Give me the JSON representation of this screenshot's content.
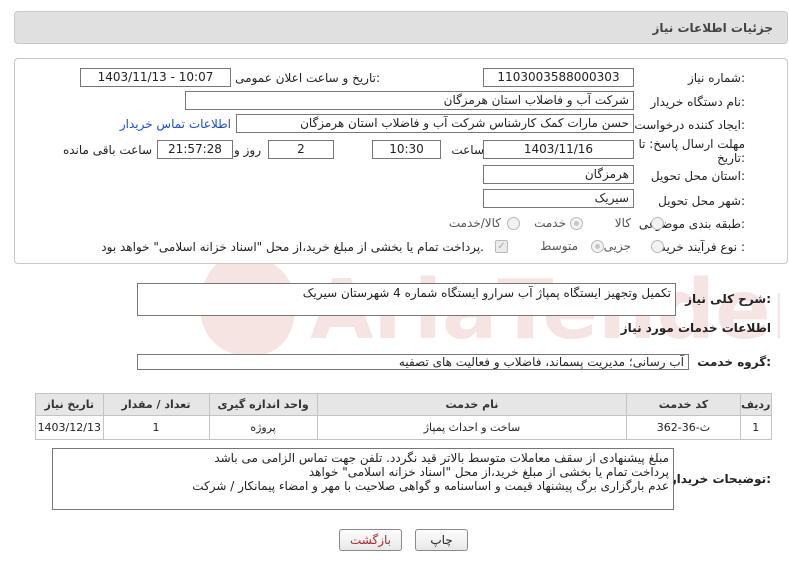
{
  "header": {
    "title": "جزئیات اطلاعات نیاز"
  },
  "fields": {
    "need_number_label": "شماره نیاز:",
    "need_number": "1103003588000303",
    "announce_label": "تاریخ و ساعت اعلان عمومی:",
    "announce_value": "1403/11/13 - 10:07",
    "buyer_org_label": "نام دستگاه خریدار:",
    "buyer_org": "شرکت آب و فاضلاب استان هرمزگان",
    "creator_label": "ایجاد کننده درخواست:",
    "creator": "حسن مارات کمک کارشناس شرکت آب و فاضلاب استان هرمزگان",
    "contact_link": "اطلاعات تماس خریدار",
    "deadline_label_1": "مهلت ارسال پاسخ: تا",
    "deadline_label_2": "تاریخ:",
    "deadline_date": "1403/11/16",
    "time_label": "ساعت",
    "deadline_time": "10:30",
    "days_value": "2",
    "days_label": "روز و",
    "remaining_time": "21:57:28",
    "remaining_label": "ساعت باقی مانده",
    "province_label": "استان محل تحویل:",
    "province": "هرمزگان",
    "city_label": "شهر محل تحویل:",
    "city": "سیریک",
    "category_label": "طبقه بندی موضوعی:",
    "category_options": [
      "کالا",
      "خدمت",
      "کالا/خدمت"
    ],
    "category_selected": "خدمت",
    "process_label": "نوع فرآیند خرید :",
    "process_options": [
      "جزیی",
      "متوسط"
    ],
    "process_selected": "متوسط",
    "payment_note": "پرداخت تمام یا بخشی از مبلغ خرید،از محل \"اسناد خزانه اسلامی\" خواهد بود."
  },
  "description": {
    "label": "شرح کلی نیاز:",
    "text": "تکمیل وتجهیز ایستگاه پمپاژ آب سرارو ایستگاه شماره 4  شهرستان سیریک"
  },
  "services": {
    "section_title": "اطلاعات خدمات مورد نیاز",
    "group_label": "گروه خدمت:",
    "group_value": "آب رسانی؛ مدیریت پسماند، فاضلاب و فعالیت های تصفیه",
    "columns": [
      "ردیف",
      "کد خدمت",
      "نام خدمت",
      "واحد اندازه گیری",
      "تعداد / مقدار",
      "تاریخ نیاز"
    ],
    "rows": [
      {
        "index": "1",
        "code": "ث-36-362",
        "name": "ساخت و احداث پمپاژ",
        "unit": "پروژه",
        "qty": "1",
        "date": "1403/12/13"
      }
    ]
  },
  "buyer_notes": {
    "label": "توضیحات خریدار:",
    "lines": [
      "مبلغ پیشنهادی از سقف معاملات متوسط بالاتر قید نگردد. تلفن جهت تماس الزامی می باشد",
      "پرداخت تمام یا بخشی از مبلغ خرید،از محل \"اسناد خزانه اسلامی\" خواهد",
      "عدم بارگزاری برگ پیشنهاد قیمت و اساسنامه و گواهی صلاحیت با مهر و امضاء پیمانکار / شرکت"
    ]
  },
  "buttons": {
    "print": "چاپ",
    "back": "بازگشت"
  },
  "watermark": {
    "text": "AriaTender.neT"
  }
}
